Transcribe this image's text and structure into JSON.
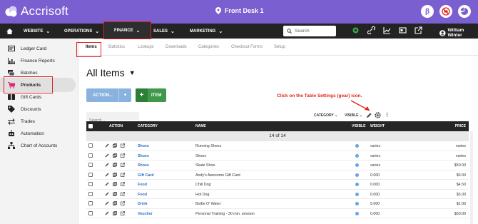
{
  "app": {
    "name": "Accrisoft",
    "location": "Front Desk 1",
    "badge_letter": "β"
  },
  "nav": {
    "items": [
      {
        "label": "WEBSITE"
      },
      {
        "label": "OPERATIONS"
      },
      {
        "label": "FINANCE"
      },
      {
        "label": "SALES"
      },
      {
        "label": "MARKETING"
      }
    ],
    "search_placeholder": "Search",
    "user": "William Winter"
  },
  "sidebar": {
    "items": [
      {
        "label": "Ledger Card",
        "icon": "ledger-card-icon"
      },
      {
        "label": "Finance Reports",
        "icon": "bar-chart-icon"
      },
      {
        "label": "Batches",
        "icon": "layers-icon"
      },
      {
        "label": "Products",
        "icon": "shopping-cart-icon"
      },
      {
        "label": "Gift Cards",
        "icon": "gift-card-icon"
      },
      {
        "label": "Discounts",
        "icon": "tag-icon"
      },
      {
        "label": "Trades",
        "icon": "swap-arrows-icon"
      },
      {
        "label": "Automation",
        "icon": "robot-icon"
      },
      {
        "label": "Chart of Accounts",
        "icon": "org-chart-icon"
      }
    ]
  },
  "tabs": [
    {
      "label": "Items"
    },
    {
      "label": "Statistics"
    },
    {
      "label": "Lookups"
    },
    {
      "label": "Downloads"
    },
    {
      "label": "Categories"
    },
    {
      "label": "Checkout Forms"
    },
    {
      "label": "Setup"
    }
  ],
  "page": {
    "title": "All Items",
    "action_button": "ACTION...",
    "add_item_button": "ITEM",
    "annotation": "Click on the Table Settings (gear) icon."
  },
  "table": {
    "search_placeholder": "Search...",
    "category_filter": "CATEGORY",
    "visible_filter": "VISIBLE",
    "columns": {
      "action": "ACTION",
      "category": "CATEGORY",
      "name": "NAME",
      "visible": "VISIBLE",
      "weight": "WEIGHT",
      "price": "PRICE"
    },
    "count": "14 of 14",
    "rows": [
      {
        "category": "Shoes",
        "name": "Running Shoes",
        "weight": "varies",
        "price": "varies"
      },
      {
        "category": "Shoes",
        "name": "Shoes",
        "weight": "varies",
        "price": "varies"
      },
      {
        "category": "Shoes",
        "name": "Skate Shoe",
        "weight": "varies",
        "price": "$50.00"
      },
      {
        "category": "Gift Card",
        "name": "Andy's Awesome Gift Card",
        "weight": "0.000",
        "price": "$0.00"
      },
      {
        "category": "Food",
        "name": "Chili Dog",
        "weight": "0.000",
        "price": "$4.50"
      },
      {
        "category": "Food",
        "name": "Hot Dog",
        "weight": "0.000",
        "price": "$3.00"
      },
      {
        "category": "Drink",
        "name": "Bottle O' Water",
        "weight": "5.000",
        "price": "$1.00"
      },
      {
        "category": "Voucher",
        "name": "Personal Training - 30 min. session",
        "weight": "0.000",
        "price": "$50.00"
      }
    ]
  },
  "colors": {
    "topbar": "#7a5fd0",
    "nav": "#232323",
    "highlight": "#e02020",
    "link": "#2b6fc4",
    "green": "#3e9a4a"
  }
}
